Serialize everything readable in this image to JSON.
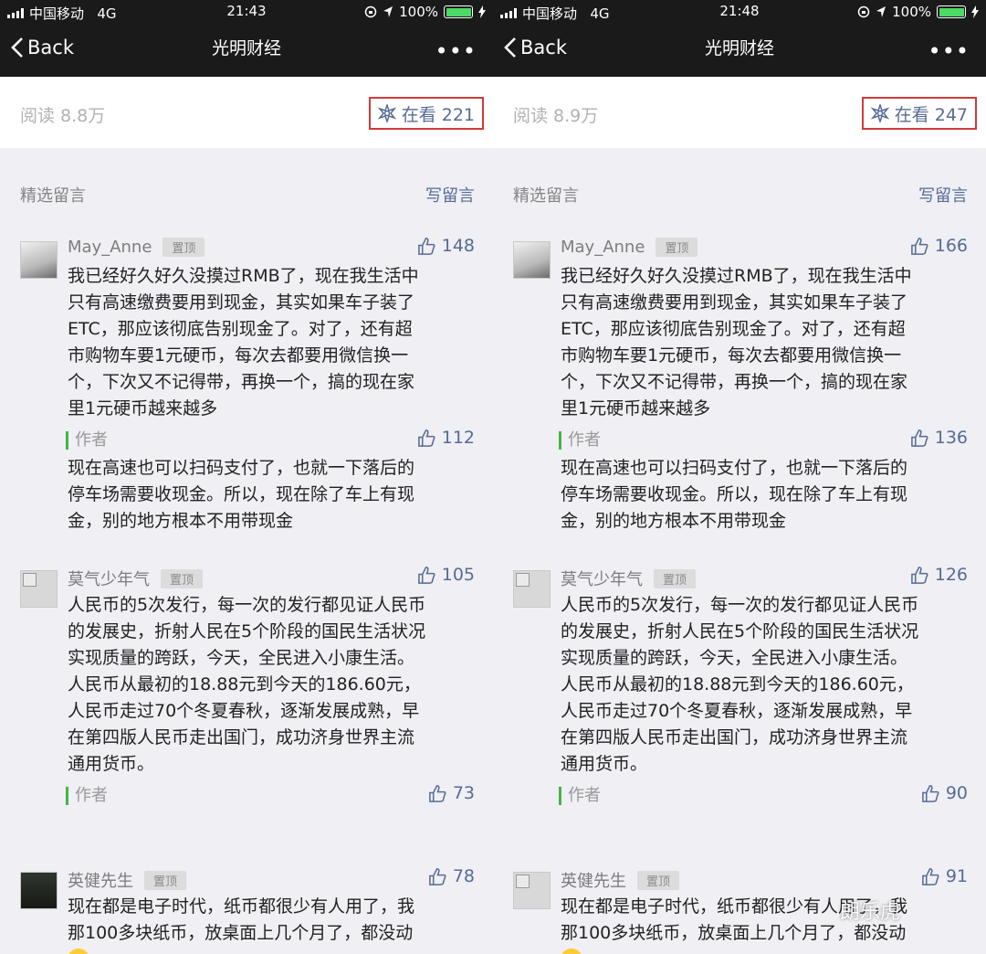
{
  "phones": [
    {
      "status": {
        "carrier": "中国移动",
        "network": "4G",
        "time": "21:43",
        "battery": "100%"
      },
      "nav": {
        "back": "Back",
        "title": "光明财经",
        "more": "•••"
      },
      "stats": {
        "read": "阅读 8.8万",
        "watching": "在看 221"
      },
      "section": {
        "title": "精选留言",
        "write": "写留言"
      },
      "comments": [
        {
          "name": "May_Anne",
          "pin": "置顶",
          "likes": "148",
          "text": "我已经好久好久没摸过RMB了，现在我生活中\n只有高速缴费要用到现金，其实如果车子装了\nETC，那应该彻底告别现金了。对了，还有超\n市购物车要1元硬币，每次去都要用微信换一\n个，下次又不记得带，再换一个，搞的现在家\n里1元硬币越来越多",
          "reply": {
            "label": "作者",
            "likes": "112",
            "text": "现在高速也可以扫码支付了，也就一下落后的\n停车场需要收现金。所以，现在除了车上有现\n金，别的地方根本不用带现金"
          }
        },
        {
          "name": "莫气少年气",
          "pin": "置顶",
          "likes": "105",
          "text": "人民币的5次发行，每一次的发行都见证人民币\n的发展史，折射人民在5个阶段的国民生活状况\n实现质量的跨跃，今天，全民进入小康生活。\n人民币从最初的18.88元到今天的186.60元，\n人民币走过70个冬夏春秋，逐渐发展成熟，早\n在第四版人民币走出国门，成功济身世界主流\n通用货币。",
          "reply": {
            "label": "作者",
            "likes": "73"
          }
        },
        {
          "name": "英健先生",
          "pin": "置顶",
          "likes": "78",
          "text": "现在都是电子时代，纸币都很少有人用了，我\n那100多块纸币，放桌面上几个月了，都没动"
        }
      ]
    },
    {
      "status": {
        "carrier": "中国移动",
        "network": "4G",
        "time": "21:48",
        "battery": "100%"
      },
      "nav": {
        "back": "Back",
        "title": "光明财经",
        "more": "•••"
      },
      "stats": {
        "read": "阅读 8.9万",
        "watching": "在看 247"
      },
      "section": {
        "title": "精选留言",
        "write": "写留言"
      },
      "comments": [
        {
          "name": "May_Anne",
          "pin": "置顶",
          "likes": "166",
          "text": "我已经好久好久没摸过RMB了，现在我生活中\n只有高速缴费要用到现金，其实如果车子装了\nETC，那应该彻底告别现金了。对了，还有超\n市购物车要1元硬币，每次去都要用微信换一\n个，下次又不记得带，再换一个，搞的现在家\n里1元硬币越来越多",
          "reply": {
            "label": "作者",
            "likes": "136",
            "text": "现在高速也可以扫码支付了，也就一下落后的\n停车场需要收现金。所以，现在除了车上有现\n金，别的地方根本不用带现金"
          }
        },
        {
          "name": "莫气少年气",
          "pin": "置顶",
          "likes": "126",
          "text": "人民币的5次发行，每一次的发行都见证人民币\n的发展史，折射人民在5个阶段的国民生活状况\n实现质量的跨跃，今天，全民进入小康生活。\n人民币从最初的18.88元到今天的186.60元，\n人民币走过70个冬夏春秋，逐渐发展成熟，早\n在第四版人民币走出国门，成功济身世界主流\n通用货币。",
          "reply": {
            "label": "作者",
            "likes": "90"
          }
        },
        {
          "name": "英健先生",
          "pin": "置顶",
          "likes": "91",
          "text": "现在都是电子时代，纸币都很少有人用了，我\n那100多块纸币，放桌面上几个月了，都没动"
        }
      ]
    }
  ],
  "watermark": "朗乐虎",
  "icons": {
    "back": "chevron-left-icon",
    "watching": "sparkle-icon",
    "like": "thumbs-up-icon",
    "signal": "signal-bars-icon",
    "location": "location-arrow-icon",
    "lock": "rotation-lock-icon",
    "battery": "battery-icon",
    "charging": "charging-bolt-icon"
  },
  "colors": {
    "accent": "#576b95",
    "author_bar": "#47b347",
    "highlight_box": "#d03a3a",
    "battery": "#4cd964"
  }
}
